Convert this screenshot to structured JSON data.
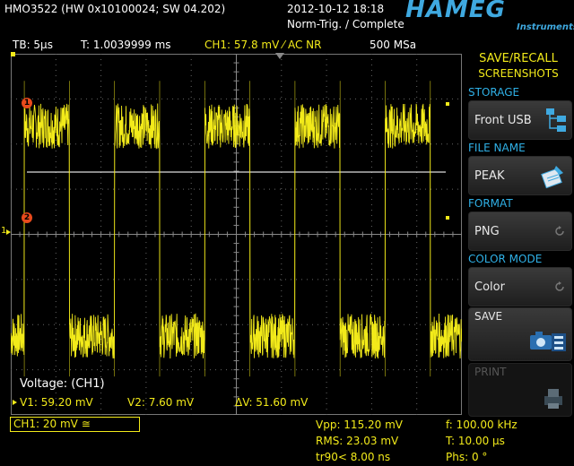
{
  "header": {
    "device": "HMO3522 (HW 0x10100024; SW 04.202)",
    "datetime": "2012-10-12 18:18",
    "trigger_status": "Norm-Trig. / Complete",
    "brand": "HAMEG",
    "brand_sub": "Instruments"
  },
  "statusbar": {
    "timebase": "TB: 5µs",
    "time": "T: 1.0039999 ms",
    "channel": "CH1: 57.8 mV ⁄ AC NR",
    "samplerate": "500 MSa"
  },
  "cursor_readout": {
    "title": "Voltage: (CH1)",
    "v1": "V1: 59.20 mV",
    "v2": "V2: 7.60 mV",
    "dv": "ΔV: 51.60 mV"
  },
  "bottom": {
    "ch1_scale": "CH1: 20 mV ≅",
    "vpp": "Vpp: 115.20 mV",
    "rms": "RMS: 23.03 mV",
    "tr90": "tr90< 8.00 ns",
    "freq": "f: 100.00 kHz",
    "period": "T: 10.00 µs",
    "phase": "Phs: 0 °"
  },
  "markers": {
    "cursor1": "1",
    "cursor2": "2",
    "ch1": "1"
  },
  "menu": {
    "title_line1": "SAVE/RECALL",
    "title_line2": "SCREENSHOTS",
    "storage_header": "STORAGE",
    "storage_value": "Front USB",
    "filename_header": "FILE NAME",
    "filename_value": "PEAK",
    "format_header": "FORMAT",
    "format_value": "PNG",
    "colormode_header": "COLOR MODE",
    "colormode_value": "Color",
    "save_label": "SAVE",
    "print_label": "PRINT"
  },
  "colors": {
    "trace": "#f2ea1a",
    "accent": "#2fb0e6",
    "cursor_marker": "#e84a1c",
    "background": "#000000"
  },
  "chart_data": {
    "type": "line",
    "series": [
      {
        "values": [
          0.0,
          0.0
        ]
      }
    ],
    "grid": true,
    "ylim": [
      -80,
      80
    ],
    "xlim": [
      0,
      50
    ]
  }
}
